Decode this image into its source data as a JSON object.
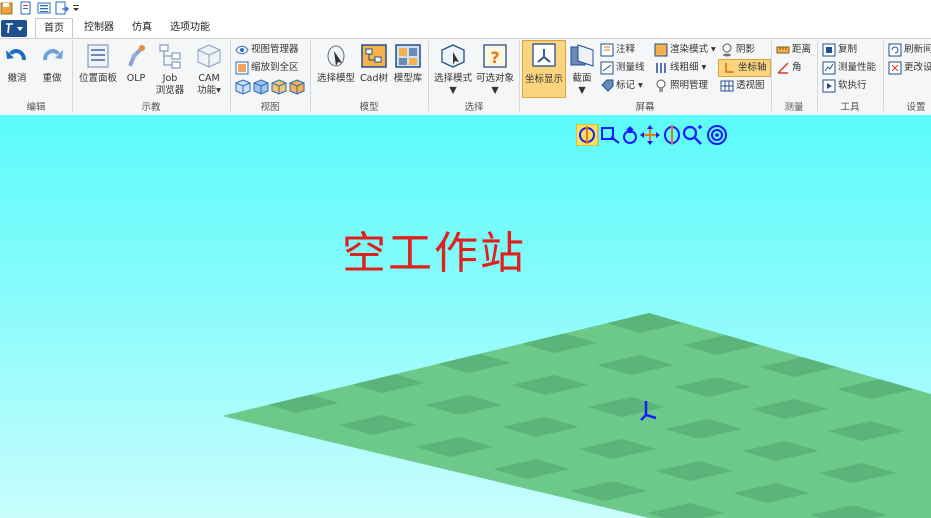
{
  "tabs": [
    {
      "label": "首页",
      "active": true
    },
    {
      "label": "控制器",
      "active": false
    },
    {
      "label": "仿真",
      "active": false
    },
    {
      "label": "选项功能",
      "active": false
    }
  ],
  "groups": {
    "edit": {
      "label": "编辑",
      "undo": "撤消",
      "redo": "重做"
    },
    "teach": {
      "label": "示教",
      "position_panel": "位置面板",
      "olp": "OLP",
      "job_line1": "Job",
      "job_line2": "浏览器",
      "cam_line1": "CAM",
      "cam_line2": "功能"
    },
    "view": {
      "label": "视图",
      "view_manager": "视图管理器",
      "zoom_all": "缩放到全区"
    },
    "model": {
      "label": "模型",
      "select_model": "选择模型",
      "cad_tree": "Cad树",
      "model_lib": "模型库"
    },
    "select": {
      "label": "选择",
      "select_mode": "选择模式",
      "selectable_obj": "可选对象"
    },
    "screen": {
      "label": "屏幕",
      "coord_display": "坐标显示",
      "section": "截面",
      "annotation": "注释",
      "measure_line": "测量线",
      "mark": "标记",
      "render_mode": "渲染模式",
      "line_width": "线粗细",
      "lighting": "照明管理",
      "shadow": "阴影",
      "coord_axis": "坐标轴",
      "perspective": "透视图"
    },
    "measure": {
      "label": "测量",
      "distance": "距离",
      "angle": "角"
    },
    "tools": {
      "label": "工具",
      "copy": "复制",
      "measure_perf": "测量性能",
      "soft_exec": "软执行"
    },
    "settings": {
      "label": "设置",
      "refresh": "刷新间",
      "change_settings": "更改设"
    }
  },
  "viewport": {
    "title": "空工作站"
  },
  "colors": {
    "title_red": "#e0201c",
    "floor_light": "#6cc98a",
    "floor_dark": "#5bb57a",
    "accent_orange": "#fbd480",
    "axis_blue": "#1a1aff"
  }
}
